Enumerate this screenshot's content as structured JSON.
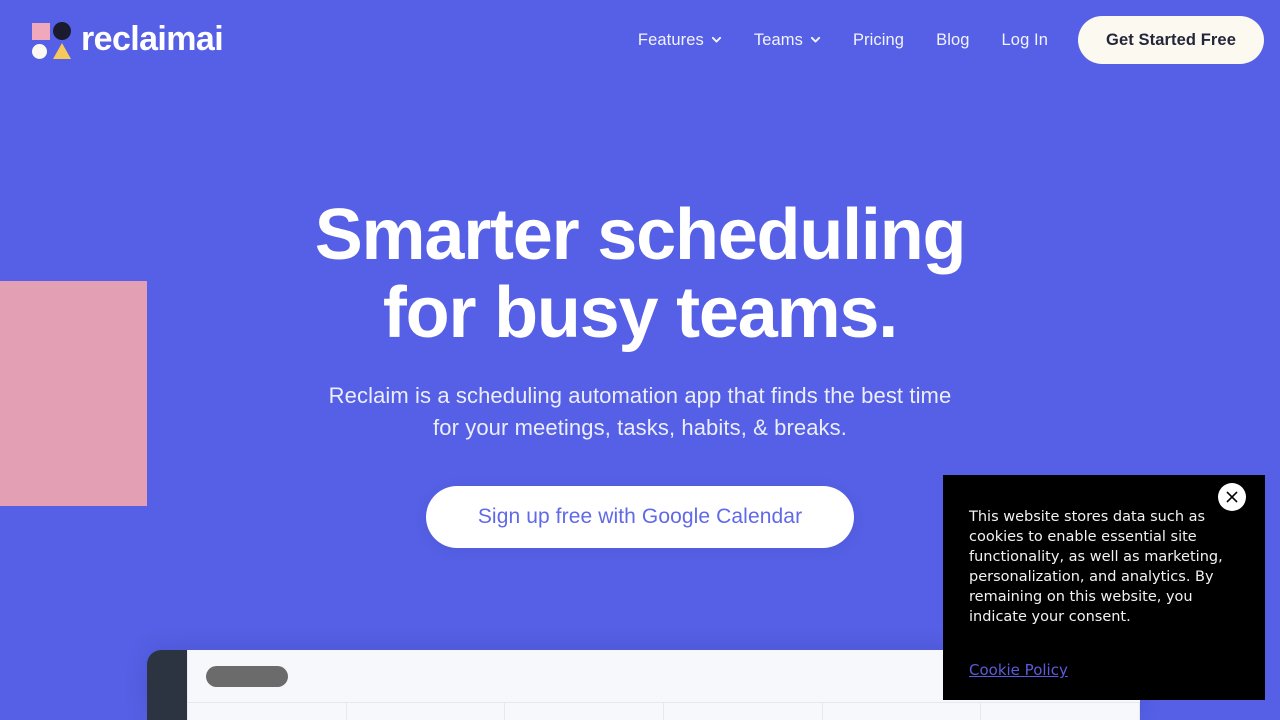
{
  "page": {
    "background_color": "#5560e6",
    "accent_pink": "#e3a0b4",
    "cream": "#fbf9f0"
  },
  "header": {
    "brand": {
      "wordmark": "reclaimai",
      "mark_icon": "reclaim-logo-mark",
      "shapes": {
        "square_color": "#f0a8bd",
        "circle_dark_color": "#1b1b2f",
        "circle_light_color": "#fbf9f2",
        "triangle_color": "#f7c95a"
      }
    },
    "nav": [
      {
        "label": "Features",
        "has_dropdown": true,
        "icon": "chevron-down-icon"
      },
      {
        "label": "Teams",
        "has_dropdown": true,
        "icon": "chevron-down-icon"
      },
      {
        "label": "Pricing",
        "has_dropdown": false,
        "icon": ""
      },
      {
        "label": "Blog",
        "has_dropdown": false,
        "icon": ""
      },
      {
        "label": "Log In",
        "has_dropdown": false,
        "icon": ""
      }
    ],
    "cta_label": "Get Started Free"
  },
  "hero": {
    "title_line1": "Smarter scheduling",
    "title_line2": "for busy teams.",
    "subtitle_line1": "Reclaim is a scheduling automation app that finds the best",
    "subtitle_line2": "time for your meetings, tasks, habits, & breaks.",
    "cta_label": "Sign up free with Google Calendar"
  },
  "app_preview": {
    "sidebar_color": "#2c3341",
    "panel_color": "#f7f8fb",
    "placeholder_pill_color": "#6b6b6b"
  },
  "cookie_banner": {
    "message": "This website stores data such as cookies to enable essential site functionality, as well as marketing, personalization, and analytics. By remaining on this website, you indicate your consent.",
    "policy_link_label": "Cookie Policy",
    "close_icon": "close-icon"
  }
}
